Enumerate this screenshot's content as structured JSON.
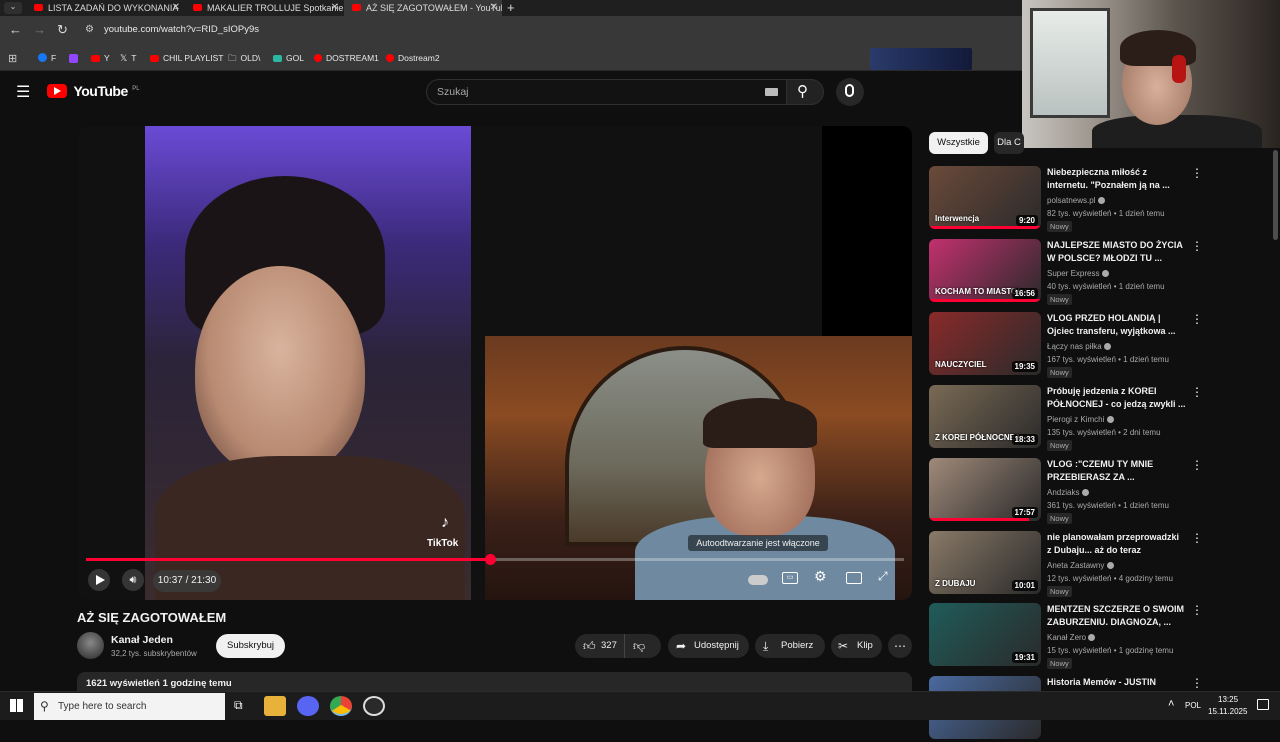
{
  "browser": {
    "tabs": [
      {
        "label": "LISTA ZADAŃ DO WYKONANIA"
      },
      {
        "label": "MAKALIER TROLLUJE Spotkanie"
      },
      {
        "label": "AŻ SIĘ ZAGOTOWAŁEM - YouTube"
      }
    ],
    "url": "youtube.com/watch?v=RID_sIOPy9s",
    "bookmarks": [
      "F",
      "Y",
      "T",
      "CHIL PLAYLIST",
      "OLD\\",
      "GOL",
      "DOSTREAM1",
      "Dostream2"
    ]
  },
  "youtube": {
    "logo_text": "YouTube",
    "region": "PL",
    "search_placeholder": "Szukaj"
  },
  "player": {
    "time": "10:37 / 21:30",
    "progress_fraction": 0.494,
    "autoplay_tooltip": "Autoodtwarzanie jest włączone",
    "tiktok_label": "TikTok"
  },
  "video": {
    "title": "AŻ SIĘ ZAGOTOWAŁEM",
    "channel": "Kanał Jeden",
    "subscribers": "32,2 tys. subskrybentów",
    "subscribe_label": "Subskrybuj",
    "likes": "327",
    "share_label": "Udostępnij",
    "download_label": "Pobierz",
    "clip_label": "Klip",
    "description": "1621 wyświetleń  1 godzinę temu"
  },
  "sidebar": {
    "chips": [
      "Wszystkie",
      "Dla C"
    ],
    "recommendations": [
      {
        "title1": "Niebezpieczna miłość z",
        "title2": "internetu. \"Poznałem ją na ...",
        "channel": "polsatnews.pl",
        "meta": "82 tys. wyświetleń • 1 dzień temu",
        "badge": "Nowy",
        "duration": "9:20",
        "thumb_text": "Interwencja",
        "color": "#6b4a3a"
      },
      {
        "title1": "NAJLEPSZE MIASTO DO ŻYCIA",
        "title2": "W POLSCE? MŁODZI TU ...",
        "channel": "Super Express",
        "meta": "40 tys. wyświetleń • 1 dzień temu",
        "badge": "Nowy",
        "duration": "16:56",
        "thumb_text": "KOCHAM TO MIASTO!",
        "color": "#c2306e"
      },
      {
        "title1": "VLOG PRZED HOLANDIĄ |",
        "title2": "Ojciec transferu, wyjątkowa ...",
        "channel": "Łączy nas piłka",
        "meta": "167 tys. wyświetleń • 1 dzień temu",
        "badge": "Nowy",
        "duration": "19:35",
        "thumb_text": "NAUCZYCIEL",
        "color": "#8a2a2a"
      },
      {
        "title1": "Próbuję jedzenia z KOREI",
        "title2": "PÓŁNOCNEJ - co jedzą zwykli ...",
        "channel": "Pierogi z Kimchi",
        "meta": "135 tys. wyświetleń • 2 dni temu",
        "badge": "Nowy",
        "duration": "18:33",
        "thumb_text": "Z KOREI PÓŁNOCNEJ",
        "color": "#7a6a55"
      },
      {
        "title1": "VLOG :\"CZEMU TY MNIE",
        "title2": "PRZEBIERASZ ZA ...",
        "channel": "Andziaks",
        "meta": "361 tys. wyświetleń • 1 dzień temu",
        "badge": "Nowy",
        "duration": "17:57",
        "thumb_text": "",
        "color": "#a08a7a"
      },
      {
        "title1": "nie planowałam przeprowadzki",
        "title2": "z Dubaju... aż do teraz",
        "channel": "Aneta Zastawny",
        "meta": "12 tys. wyświetleń • 4 godziny temu",
        "badge": "Nowy",
        "duration": "10:01",
        "thumb_text": "Z DUBAJU",
        "color": "#8a7a68"
      },
      {
        "title1": "MENTZEN SZCZERZE O SWOIM",
        "title2": "ZABURZENIU. DIAGNOZA, ...",
        "channel": "Kanał Zero",
        "meta": "15 tys. wyświetleń • 1 godzinę temu",
        "badge": "Nowy",
        "duration": "19:31",
        "thumb_text": "",
        "color": "#1f5c5a"
      },
      {
        "title1": "Historia Memów - JUSTIN",
        "title2": "",
        "channel": "",
        "meta": "",
        "badge": "",
        "duration": "",
        "thumb_text": "",
        "color": "#4a6aa0"
      }
    ]
  },
  "taskbar": {
    "search_placeholder": "Type here to search",
    "lang": "POL",
    "time": "13:25",
    "date": "15.11.2025"
  }
}
